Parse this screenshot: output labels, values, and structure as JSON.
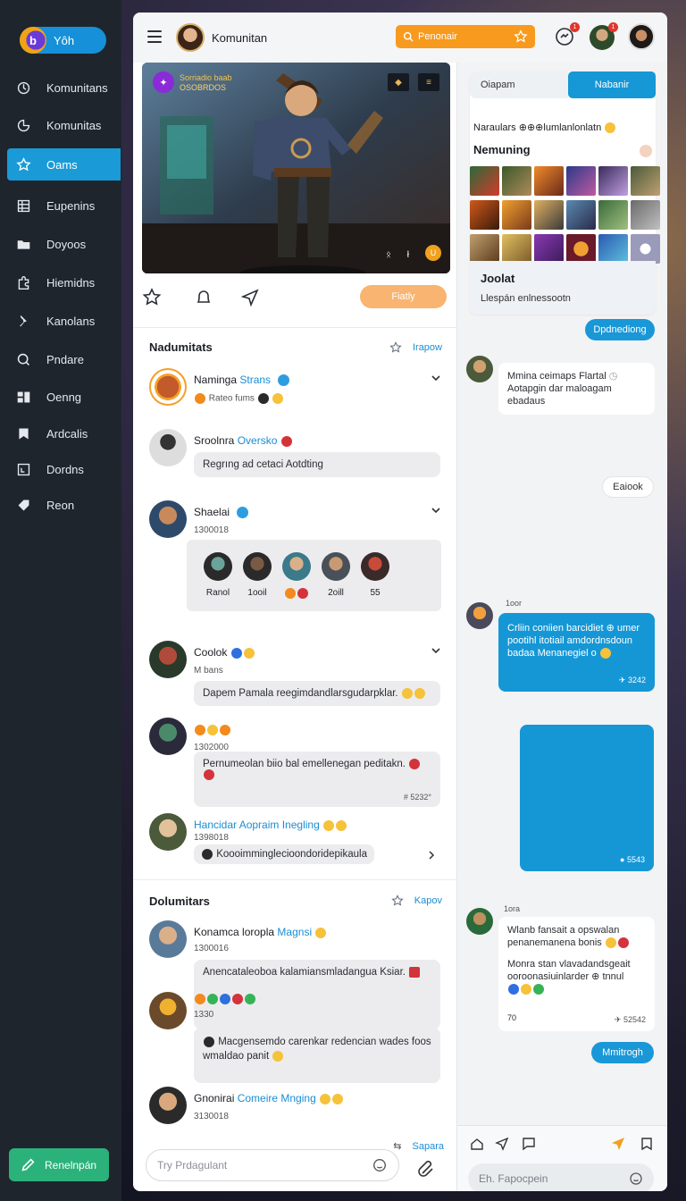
{
  "brand": {
    "logo_letter": "b",
    "name": "Yôh"
  },
  "sidebar": {
    "items": [
      {
        "label": "Komunitans",
        "icon": "community-icon",
        "active": false
      },
      {
        "label": "Komunitas",
        "icon": "chart-icon",
        "active": false
      },
      {
        "label": "Oams",
        "icon": "star-icon",
        "active": true
      },
      {
        "label": "Eupenins",
        "icon": "grid-icon",
        "active": false
      },
      {
        "label": "Doyoos",
        "icon": "folder-icon",
        "active": false
      },
      {
        "label": "Hiemidns",
        "icon": "puzzle-icon",
        "active": false
      },
      {
        "label": "Kanolans",
        "icon": "pin-icon",
        "active": false
      },
      {
        "label": "Pndare",
        "icon": "search-icon",
        "active": false
      },
      {
        "label": "Oenng",
        "icon": "dashboard-icon",
        "active": false
      },
      {
        "label": "Ardcalis",
        "icon": "bookmark-icon",
        "active": false
      },
      {
        "label": "Dordns",
        "icon": "document-icon",
        "active": false
      },
      {
        "label": "Reon",
        "icon": "tag-icon",
        "active": false
      }
    ],
    "compose_label": "Renelnpán"
  },
  "topbar": {
    "title": "Komunitan",
    "search_placeholder": "Penonair",
    "badge_1": "1",
    "badge_2": "1"
  },
  "hero": {
    "label_line1": "Sorriadio baab",
    "label_line2": "OSOBRDOS",
    "coin": "U",
    "mini_1": "ᛟ",
    "mini_2": "ł"
  },
  "actions": {
    "reply_label": "Fiatly"
  },
  "feed": {
    "section_title": "Nadumitats",
    "section_link": "Irapow",
    "posts": [
      {
        "name": "Naminga",
        "name_accent": "Strans",
        "sub": "Rateo fums",
        "bubble": ""
      },
      {
        "name": "Sroolnra",
        "name_accent": "Oversko",
        "sub": "",
        "bubble": "Regrıng ad cetaci Aotdting"
      },
      {
        "name": "Shaelai",
        "name_accent": "",
        "sub": "1300018",
        "bubble": ""
      },
      {
        "name": "Coolok",
        "name_accent": "",
        "sub": "M bans",
        "bubble": "Dapem Pamala reegimdandlarsgudarpklar."
      },
      {
        "name": "",
        "name_accent": "",
        "sub": "1302000",
        "bubble": "Pernumeolan biio bal emellenegan peditakn.",
        "time": "# 5232°"
      },
      {
        "name": "",
        "name_accent": "Hancidar Aopraim Inegling",
        "sub": "1398018",
        "bubble": "Koooimminglecioondoridepikaula"
      }
    ],
    "members": [
      {
        "label": "Ranol"
      },
      {
        "label": "1ooil"
      },
      {
        "label": ""
      },
      {
        "label": "2oill"
      },
      {
        "label": "55"
      }
    ]
  },
  "feed2": {
    "section_title": "Dolumitars",
    "section_link": "Kapov",
    "posts": [
      {
        "name": "Konamca",
        "name_accent": "loropla",
        "name_accent2": "Magnsi",
        "sub": "1300016",
        "bubble": "Anencataleoboa kalamiansmladangua Ksiar."
      },
      {
        "name": "",
        "sub": "1330",
        "bubble": "Macgensemdo carenkar redencian wades foos wmaldao panit"
      },
      {
        "name": "Gnonirai",
        "name_accent": "Comeire Mnging",
        "sub": "3130018",
        "bubble": ""
      }
    ],
    "footer_link": "Sapara",
    "input_placeholder": "Try Prdagulant"
  },
  "panel": {
    "tab_1": "Oiapam",
    "tab_2": "Nabanir",
    "info_line": "Naraulars ⊕⊕⊕lumlanlonlatn",
    "info_head": "Nemuning",
    "footer_title": "Joolat",
    "footer_sub": "Llespán enlnessootn"
  },
  "chat": {
    "pill_1": "Dpdnediong",
    "msg_1_line1": "Mmina ceimaps Flartal",
    "msg_1_line2": "Aotapgin dar maloagam ebadaus",
    "pill_2": "Eaiook",
    "msg_2_label": "1oor",
    "msg_2_text": "Crliin coniien barcidiet ⊕ umer pootihl itotiail amdordnsdoun badaa Menanegiel o",
    "msg_2_time": "✈ 3242",
    "msg_3_time": "● 5543",
    "msg_4_label": "1ora",
    "msg_4_text1": "Wlanb fansait a opswalan penanemanena bonis",
    "msg_4_text2": "Monra stan vlavadandsgeait ooroonasiuinlarder ⊕ tnnul",
    "msg_4_footer_left": "70",
    "msg_4_time": "✈ 52542",
    "pill_3": "Mmitrogh",
    "input_placeholder": "Eh. Fapocpein"
  }
}
